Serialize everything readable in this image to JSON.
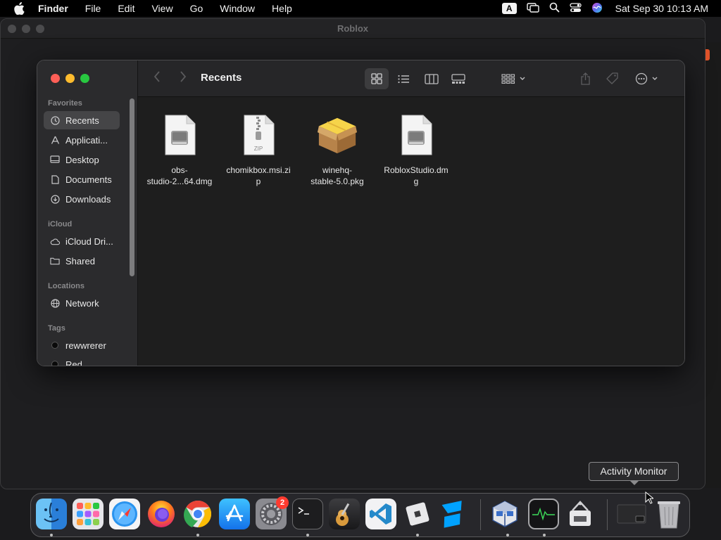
{
  "menubar": {
    "app_name": "Finder",
    "items": [
      "File",
      "Edit",
      "View",
      "Go",
      "Window",
      "Help"
    ],
    "input_source": "A",
    "clock": "Sat Sep 30  10:13 AM"
  },
  "background_window": {
    "title": "Roblox"
  },
  "finder": {
    "location_title": "Recents",
    "sidebar": {
      "favorites_header": "Favorites",
      "favorites": [
        {
          "label": "Recents",
          "icon": "clock-icon",
          "active": true
        },
        {
          "label": "Applicati...",
          "icon": "applications-icon"
        },
        {
          "label": "Desktop",
          "icon": "desktop-icon"
        },
        {
          "label": "Documents",
          "icon": "document-icon"
        },
        {
          "label": "Downloads",
          "icon": "download-icon"
        }
      ],
      "icloud_header": "iCloud",
      "icloud": [
        {
          "label": "iCloud Dri...",
          "icon": "cloud-icon"
        },
        {
          "label": "Shared",
          "icon": "shared-folder-icon"
        }
      ],
      "locations_header": "Locations",
      "locations": [
        {
          "label": "Network",
          "icon": "globe-icon"
        }
      ],
      "tags_header": "Tags",
      "tags": [
        {
          "label": "rewwrerer",
          "color": "#0a0a0a"
        },
        {
          "label": "Red",
          "color": "#0a0a0a"
        }
      ]
    },
    "files": [
      {
        "name": "obs-\nstudio-2...64.dmg",
        "type": "dmg"
      },
      {
        "name": "chomikbox.msi.zi\np",
        "type": "zip",
        "badge": "ZIP"
      },
      {
        "name": "winehq-\nstable-5.0.pkg",
        "type": "pkg"
      },
      {
        "name": "RobloxStudio.dm\ng",
        "type": "dmg"
      }
    ]
  },
  "tooltip": {
    "text": "Activity Monitor"
  },
  "dock": {
    "apps": [
      {
        "name": "Finder",
        "running": true
      },
      {
        "name": "Launchpad",
        "running": false
      },
      {
        "name": "Safari",
        "running": false
      },
      {
        "name": "Firefox",
        "running": false
      },
      {
        "name": "Google Chrome",
        "running": true
      },
      {
        "name": "App Store",
        "running": false
      },
      {
        "name": "System Settings",
        "running": false,
        "badge": "2"
      },
      {
        "name": "Terminal",
        "running": true
      },
      {
        "name": "GarageBand",
        "running": false
      },
      {
        "name": "Visual Studio Code",
        "running": false
      },
      {
        "name": "Roblox",
        "running": true
      },
      {
        "name": "Roblox Studio",
        "running": false
      },
      {
        "name": "VirtualBox",
        "running": true
      },
      {
        "name": "Activity Monitor",
        "running": true
      },
      {
        "name": "Archive Utility",
        "running": false
      },
      {
        "name": "Minimized Window",
        "running": false
      },
      {
        "name": "Trash",
        "running": false
      }
    ]
  }
}
